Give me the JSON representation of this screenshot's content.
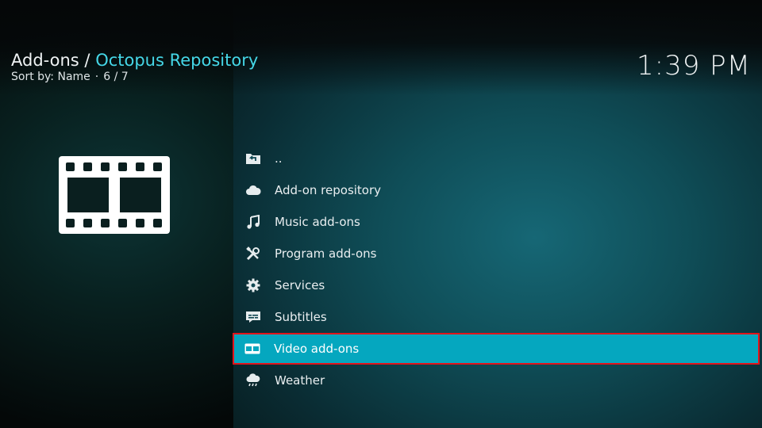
{
  "header": {
    "section": "Add-ons",
    "separator": "/",
    "repository": "Octopus Repository",
    "sort_label": "Sort by: Name",
    "position_sep": "·",
    "position": "6 / 7"
  },
  "clock": "1:39 PM",
  "poster": {
    "icon": "film-strip-icon"
  },
  "list": {
    "items": [
      {
        "label": "..",
        "icon": "folder-back-icon",
        "selected": false
      },
      {
        "label": "Add-on repository",
        "icon": "cloud-icon",
        "selected": false
      },
      {
        "label": "Music add-ons",
        "icon": "music-note-icon",
        "selected": false
      },
      {
        "label": "Program add-ons",
        "icon": "tools-icon",
        "selected": false
      },
      {
        "label": "Services",
        "icon": "gear-icon",
        "selected": false
      },
      {
        "label": "Subtitles",
        "icon": "subtitles-icon",
        "selected": false
      },
      {
        "label": "Video add-ons",
        "icon": "film-icon",
        "selected": true
      },
      {
        "label": "Weather",
        "icon": "weather-icon",
        "selected": false
      }
    ]
  },
  "colors": {
    "accent": "#45d7e7",
    "selected_bg": "#05a7bf",
    "selected_border": "#e2141b"
  }
}
